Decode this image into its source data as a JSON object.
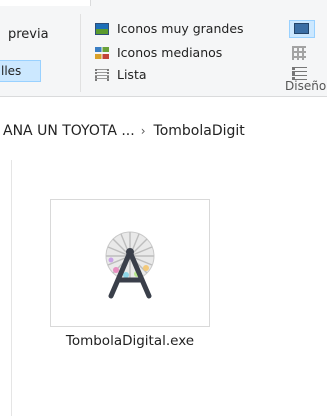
{
  "ribbon": {
    "preview_label": "previa",
    "details_label": "lles",
    "layout_items": [
      {
        "label": "Iconos muy grandes",
        "icon": "extra-large-icons-icon"
      },
      {
        "label": "Iconos medianos",
        "icon": "medium-icons-icon"
      },
      {
        "label": "Lista",
        "icon": "list-view-icon"
      }
    ],
    "group_label": "Diseño"
  },
  "breadcrumb": {
    "items": [
      "ANA UN TOYOTA ...",
      "TombolaDigit"
    ]
  },
  "files": [
    {
      "name": "TombolaDigital.exe",
      "icon": "ferris-wheel-app-icon"
    }
  ]
}
